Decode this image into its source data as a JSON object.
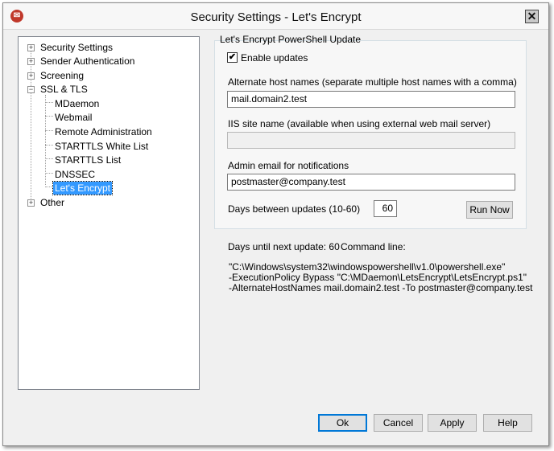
{
  "window": {
    "title": "Security Settings - Let's Encrypt",
    "app_icon": "mdaemon-logo-icon",
    "close_glyph": "✕"
  },
  "tree": {
    "top_items": [
      {
        "label": "Security Settings",
        "expander": "+"
      },
      {
        "label": "Sender Authentication",
        "expander": "+"
      },
      {
        "label": "Screening",
        "expander": "+"
      },
      {
        "label": "SSL & TLS",
        "expander": "−"
      }
    ],
    "children": [
      {
        "label": "MDaemon"
      },
      {
        "label": "Webmail"
      },
      {
        "label": "Remote Administration"
      },
      {
        "label": "STARTTLS White List"
      },
      {
        "label": "STARTTLS List"
      },
      {
        "label": "DNSSEC"
      },
      {
        "label": "Let's Encrypt",
        "selected": true
      }
    ],
    "other": {
      "label": "Other",
      "expander": "+"
    }
  },
  "panel": {
    "group_title": "Let's Encrypt PowerShell Update",
    "enable_updates": {
      "label": "Enable updates",
      "checked": true,
      "glyph": "✔"
    },
    "alt_hosts": {
      "label": "Alternate host names (separate multiple host names with a comma)",
      "value": "mail.domain2.test"
    },
    "iis_site": {
      "label": "IIS site name (available when using external web mail server)",
      "value": ""
    },
    "admin_email": {
      "label": "Admin email for notifications",
      "value": "postmaster@company.test"
    },
    "days_between": {
      "label": "Days between updates (10-60)",
      "value": "60"
    },
    "run_now_label": "Run Now"
  },
  "info": {
    "days_until": "Days until next update: 60",
    "command_line_label": "Command line:",
    "command_lines": [
      "\"C:\\Windows\\system32\\windowspowershell\\v1.0\\powershell.exe\"",
      "-ExecutionPolicy Bypass \"C:\\MDaemon\\LetsEncrypt\\LetsEncrypt.ps1\"",
      "-AlternateHostNames mail.domain2.test -To postmaster@company.test"
    ]
  },
  "footer": {
    "ok": "Ok",
    "cancel": "Cancel",
    "apply": "Apply",
    "help": "Help"
  }
}
